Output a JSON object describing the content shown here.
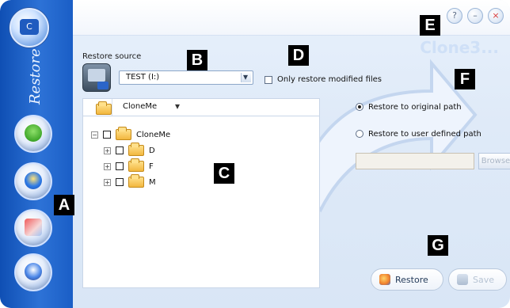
{
  "app": {
    "brand_text": "Clone3...",
    "sidebar_section": "Restore",
    "window_controls": {
      "help": "?",
      "minimize": "–",
      "close": "×"
    }
  },
  "form": {
    "restore_source_label": "Restore source",
    "restore_source_value": "TEST (I:)",
    "only_modified_label": "Only restore modified files",
    "folder_bar_label": "CloneMe",
    "tree": [
      {
        "label": "CloneMe",
        "level": 0
      },
      {
        "label": "D",
        "level": 1
      },
      {
        "label": "F",
        "level": 1
      },
      {
        "label": "M",
        "level": 1
      }
    ],
    "restore_to_original": "Restore to original path",
    "restore_to_user_defined": "Restore to user defined path",
    "browse_label": "Browse"
  },
  "actions": {
    "restore_label": "Restore",
    "save_label": "Save"
  },
  "callouts": {
    "A": "A",
    "B": "B",
    "C": "C",
    "D": "D",
    "E": "E",
    "F": "F",
    "G": "G"
  },
  "colors": {
    "sidebar_blue": "#1a5ec6",
    "panel_bg": "#dfeaf8",
    "border": "#c9d6e8"
  }
}
